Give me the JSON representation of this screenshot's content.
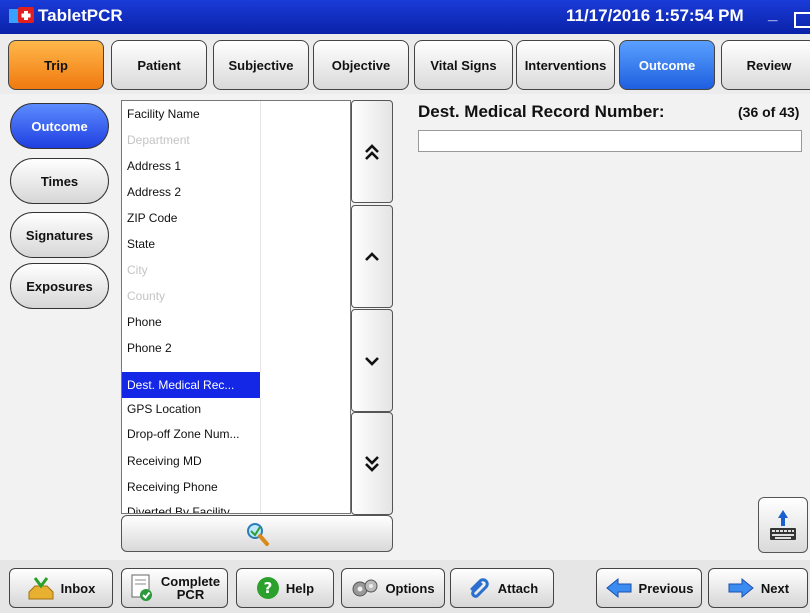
{
  "app": {
    "title": "TabletPCR",
    "datetime": "11/17/2016 1:57:54 PM",
    "min_label": "_"
  },
  "tabs": [
    {
      "label": "Trip"
    },
    {
      "label": "Patient"
    },
    {
      "label": "Subjective"
    },
    {
      "label": "Objective"
    },
    {
      "label": "Vital Signs"
    },
    {
      "label": "Interventions"
    },
    {
      "label": "Outcome"
    },
    {
      "label": "Review"
    }
  ],
  "sidebar": [
    {
      "label": "Outcome"
    },
    {
      "label": "Times"
    },
    {
      "label": "Signatures"
    },
    {
      "label": "Exposures"
    }
  ],
  "fields_list": [
    {
      "label": "Facility Name",
      "state": "normal"
    },
    {
      "label": "Department",
      "state": "disabled"
    },
    {
      "label": "Address 1",
      "state": "normal"
    },
    {
      "label": "Address 2",
      "state": "normal"
    },
    {
      "label": "ZIP Code",
      "state": "normal"
    },
    {
      "label": "State",
      "state": "normal"
    },
    {
      "label": "City",
      "state": "disabled"
    },
    {
      "label": "County",
      "state": "disabled"
    },
    {
      "label": "Phone",
      "state": "normal"
    },
    {
      "label": "Phone 2",
      "state": "normal"
    },
    {
      "label": "Dest. Medical Rec...",
      "state": "selected"
    },
    {
      "label": "GPS Location",
      "state": "normal"
    },
    {
      "label": "Drop-off Zone Num...",
      "state": "normal"
    },
    {
      "label": "Receiving MD",
      "state": "normal"
    },
    {
      "label": "Receiving Phone",
      "state": "normal"
    },
    {
      "label": "Diverted By Facility",
      "state": "normal"
    }
  ],
  "scroll_buttons": {
    "page_up": "≈",
    "up": "^",
    "down": "ˇ",
    "page_down": "≈"
  },
  "field": {
    "title": "Dest. Medical Record Number:",
    "position": "(36 of 43)",
    "value": ""
  },
  "bottom": {
    "inbox": "Inbox",
    "complete_line1": "Complete",
    "complete_line2": "PCR",
    "help": "Help",
    "options": "Options",
    "attach": "Attach",
    "previous": "Previous",
    "next": "Next"
  },
  "colors": {
    "titlebar": "#0a22a8",
    "active_tab_orange": "#f07a10",
    "active_blue": "#1f5fe0",
    "selection": "#1426e6"
  }
}
